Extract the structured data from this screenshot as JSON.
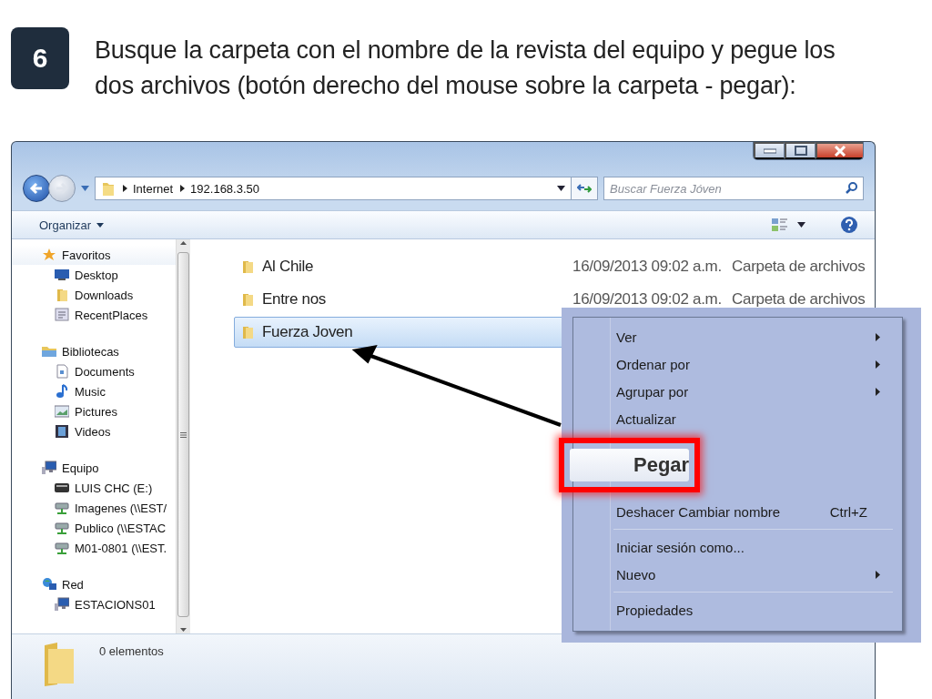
{
  "step": {
    "number": "6",
    "instruction": "Busque la carpeta con el nombre de la revista del equipo y pegue los dos archivos (botón derecho del mouse sobre la carpeta - pegar):"
  },
  "window": {
    "address": {
      "path": [
        "Internet",
        "192.168.3.50"
      ]
    },
    "search": {
      "placeholder": "Buscar Fuerza Jóven"
    },
    "toolbar": {
      "organize": "Organizar"
    },
    "sidebar": {
      "groups": [
        {
          "label": "Favoritos",
          "kind": "star",
          "children": [
            {
              "label": "Desktop",
              "kind": "desktop"
            },
            {
              "label": "Downloads",
              "kind": "folder"
            },
            {
              "label": "RecentPlaces",
              "kind": "recent"
            }
          ]
        },
        {
          "label": "Bibliotecas",
          "kind": "library",
          "children": [
            {
              "label": "Documents",
              "kind": "document"
            },
            {
              "label": "Music",
              "kind": "music"
            },
            {
              "label": "Pictures",
              "kind": "pictures"
            },
            {
              "label": "Videos",
              "kind": "video"
            }
          ]
        },
        {
          "label": "Equipo",
          "kind": "computer",
          "children": [
            {
              "label": "LUIS CHC (E:)",
              "kind": "drive"
            },
            {
              "label": "Imagenes (\\\\EST/",
              "kind": "netdrive"
            },
            {
              "label": "Publico (\\\\ESTAC",
              "kind": "netdrive"
            },
            {
              "label": "M01-0801 (\\\\EST.",
              "kind": "netdrive"
            }
          ]
        },
        {
          "label": "Red",
          "kind": "network",
          "children": [
            {
              "label": "ESTACIONS01",
              "kind": "computer"
            }
          ]
        }
      ]
    },
    "files": [
      {
        "name": "Al Chile",
        "date": "16/09/2013 09:02 a.m.",
        "type": "Carpeta de archivos",
        "selected": false
      },
      {
        "name": "Entre nos",
        "date": "16/09/2013 09:02 a.m.",
        "type": "Carpeta de archivos",
        "selected": false
      },
      {
        "name": "Fuerza Joven",
        "selected": true
      }
    ],
    "status_bar": {
      "count": "0 elementos"
    }
  },
  "context_menu": {
    "items": [
      {
        "kind": "item",
        "label": "Ver",
        "submenu": true,
        "highlighted": false
      },
      {
        "kind": "item",
        "label": "Ordenar por",
        "submenu": true,
        "highlighted": false
      },
      {
        "kind": "item",
        "label": "Agrupar por",
        "submenu": true,
        "highlighted": false
      },
      {
        "kind": "item",
        "label": "Actualizar",
        "submenu": false,
        "highlighted": false
      },
      {
        "kind": "item",
        "label": "Pegar",
        "highlighted": true
      },
      {
        "kind": "item",
        "label": "Deshacer Cambiar nombre",
        "shortcut": "Ctrl+Z",
        "submenu": false,
        "highlighted": false
      },
      {
        "kind": "separator"
      },
      {
        "kind": "item",
        "label": "Iniciar sesión como...",
        "submenu": false,
        "highlighted": false
      },
      {
        "kind": "item",
        "label": "Nuevo",
        "submenu": true,
        "highlighted": false
      },
      {
        "kind": "separator"
      },
      {
        "kind": "item",
        "label": "Propiedades",
        "submenu": false,
        "highlighted": false
      }
    ]
  }
}
